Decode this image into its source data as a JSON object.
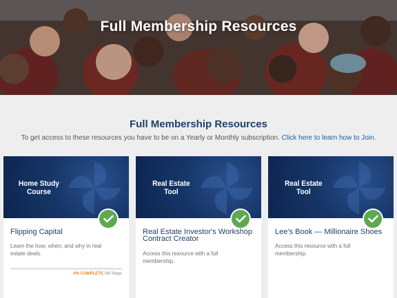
{
  "hero": {
    "title": "Full Membership Resources"
  },
  "section": {
    "title": "Full Membership Resources",
    "subtitle": "To get access to these resources you have to be on a Yearly or Monthly subscription.",
    "join_link": "Click here to learn how to Join."
  },
  "colors": {
    "navy": "#1e4068",
    "link": "#1f5ca8",
    "check_green": "#5ea84f",
    "progress_orange": "#e08a1c"
  },
  "cards": [
    {
      "banner_line1": "Home Study",
      "banner_line2": "Course",
      "title": "Flipping Capital",
      "description": "Learn the how, when, and why in real estate deals.",
      "status_icon": "check-icon",
      "progress": {
        "percent": 0,
        "percent_label": "0% COMPLETE",
        "steps_label": "0/8 Steps"
      }
    },
    {
      "banner_line1": "Real Estate",
      "banner_line2": "Tool",
      "title": "Real Estate Investor's Workshop Contract Creator",
      "description": "Access this resource with a full membership.",
      "status_icon": "check-icon"
    },
    {
      "banner_line1": "Real Estate",
      "banner_line2": "Tool",
      "title": "Lee’s Book — Millionaire Shoes",
      "description": "Access this resource with a full membership.",
      "status_icon": "check-icon"
    }
  ]
}
